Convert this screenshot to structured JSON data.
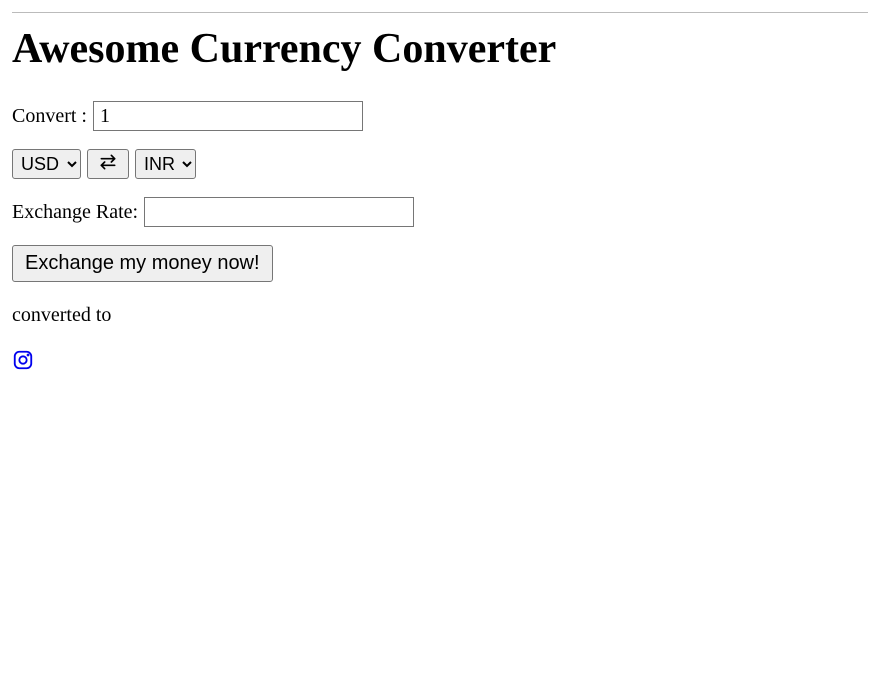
{
  "title": "Awesome Currency Converter",
  "convert": {
    "label": "Convert :",
    "value": "1"
  },
  "currencies": {
    "from_selected": "USD",
    "to_selected": "INR"
  },
  "exchange_rate": {
    "label": "Exchange Rate:",
    "value": ""
  },
  "exchange_button_label": "Exchange my money now!",
  "result_prefix": "",
  "result_converted_text": "converted to",
  "result_suffix": ""
}
